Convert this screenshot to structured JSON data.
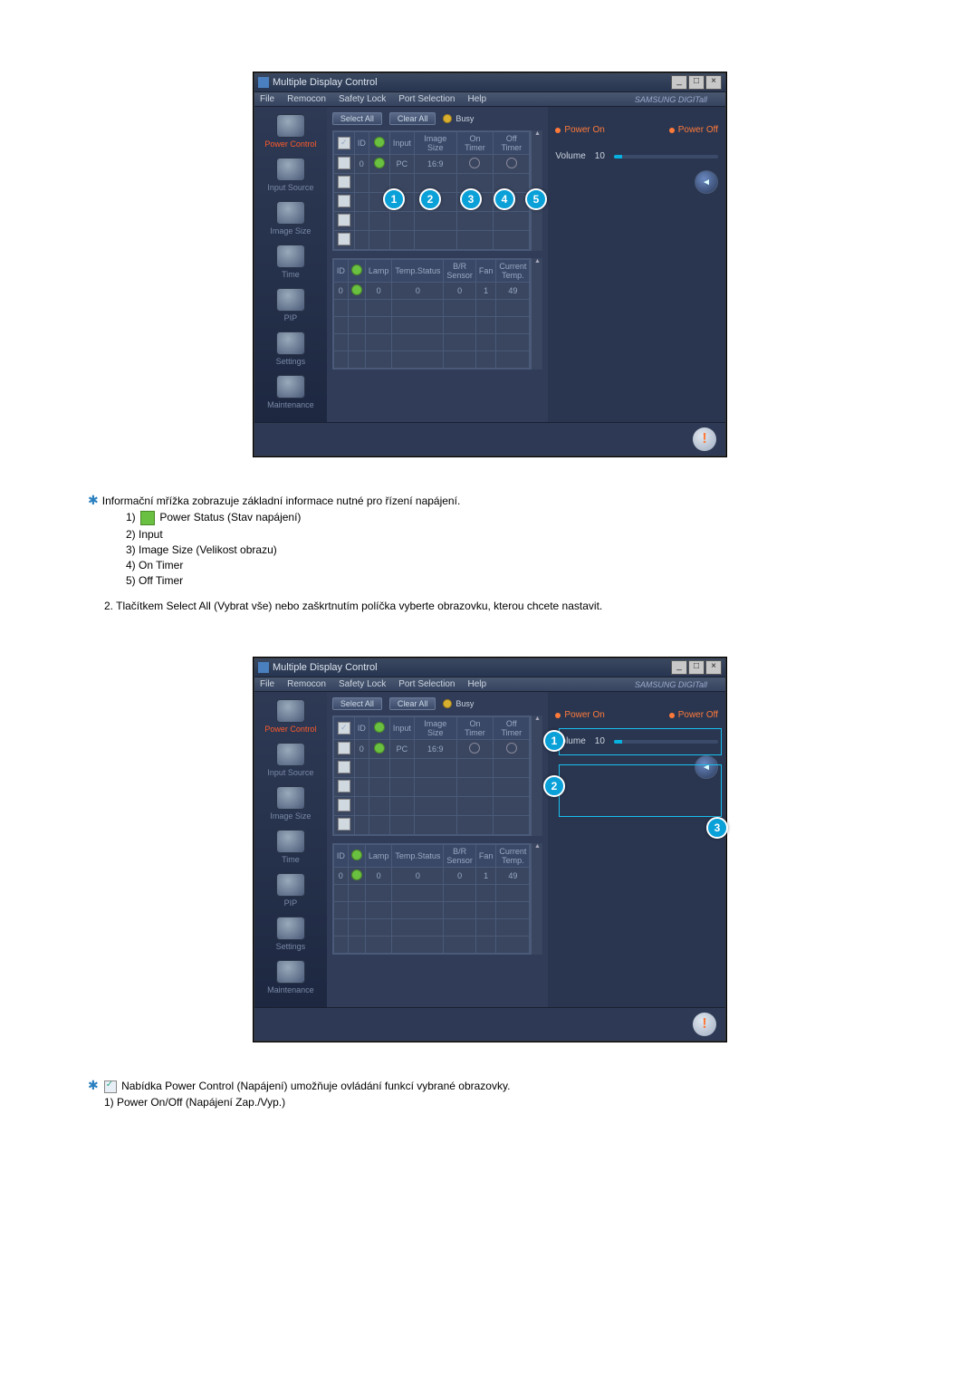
{
  "app": {
    "title": "Multiple Display Control",
    "menu": [
      "File",
      "Remocon",
      "Safety Lock",
      "Port Selection",
      "Help"
    ],
    "brand": "SAMSUNG DIGITall"
  },
  "sidebar": {
    "items": [
      {
        "label": "Power Control"
      },
      {
        "label": "Input Source"
      },
      {
        "label": "Image Size"
      },
      {
        "label": "Time"
      },
      {
        "label": "PIP"
      },
      {
        "label": "Settings"
      },
      {
        "label": "Maintenance"
      }
    ]
  },
  "toolbar": {
    "select_all": "Select All",
    "clear_all": "Clear All",
    "busy": "Busy"
  },
  "grid1": {
    "headers": [
      "",
      "ID",
      "",
      "Input",
      "Image Size",
      "On Timer",
      "Off Timer"
    ],
    "row0": {
      "id": "0",
      "input": "PC",
      "image_size": "16:9"
    }
  },
  "grid2": {
    "headers": [
      "ID",
      "",
      "Lamp",
      "Temp.Status",
      "B/R Sensor",
      "Fan",
      "Current Temp."
    ],
    "row0": {
      "id": "0",
      "lamp": "0",
      "temp_status": "0",
      "br_sensor": "0",
      "fan": "1",
      "temp": "49"
    }
  },
  "right": {
    "power_on": "Power On",
    "power_off": "Power Off",
    "volume_label": "Volume",
    "volume_value": "10"
  },
  "doc_text": {
    "intro": "Informační mřížka zobrazuje základní informace nutné pro řízení napájení.",
    "li1_prefix": "1) ",
    "li1_suffix": " Power Status (Stav napájení)",
    "li2": "2) Input",
    "li3": "3) Image Size (Velikost obrazu)",
    "li4": "4) On Timer",
    "li5": "5) Off Timer",
    "step2": "2. Tlačítkem Select All (Vybrat vše) nebo zaškrtnutím políčka vyberte obrazovku, kterou chcete nastavit.",
    "footer_star_prefix": " Nabídka Power Control (Napájení) umožňuje ovládání funkcí vybrané obrazovky.",
    "footer_1": "1) Power On/Off (Napájení Zap./Vyp.)"
  },
  "callouts_top": [
    "1",
    "2",
    "3",
    "4",
    "5"
  ],
  "callouts_bottom": [
    "1",
    "2",
    "3"
  ]
}
